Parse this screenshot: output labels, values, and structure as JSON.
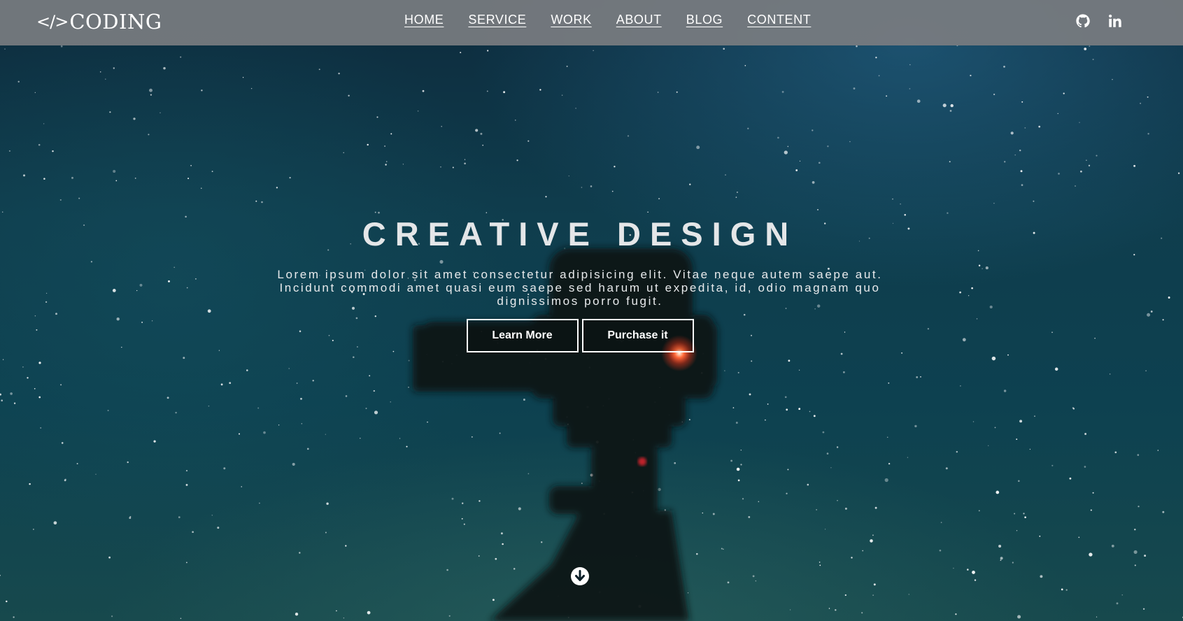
{
  "brand": {
    "mark": "</>",
    "name": "CODING"
  },
  "nav": {
    "items": [
      {
        "label": "HOME"
      },
      {
        "label": "SERVICE"
      },
      {
        "label": "WORK"
      },
      {
        "label": "ABOUT"
      },
      {
        "label": "BLOG"
      },
      {
        "label": "CONTENT"
      }
    ]
  },
  "social": [
    {
      "icon": "github-icon"
    },
    {
      "icon": "linkedin-icon"
    }
  ],
  "hero": {
    "title": "CREATIVE DESIGN",
    "text": "Lorem ipsum dolor sit amet consectetur adipisicing elit. Vitae neque autem saepe aut. Incidunt commodi amet quasi eum saepe sed harum ut expedita, id, odio magnam quo dignissimos porro fugit.",
    "primary_button": "Learn More",
    "secondary_button": "Purchase it",
    "scroll_icon": "arrow-down-circle-icon"
  },
  "colors": {
    "navbar": "#7b7e82",
    "text": "#ffffff",
    "sky_dark": "#0d2b3d",
    "sky_teal": "#0f4150",
    "camera_led": "#ff4a2a"
  }
}
